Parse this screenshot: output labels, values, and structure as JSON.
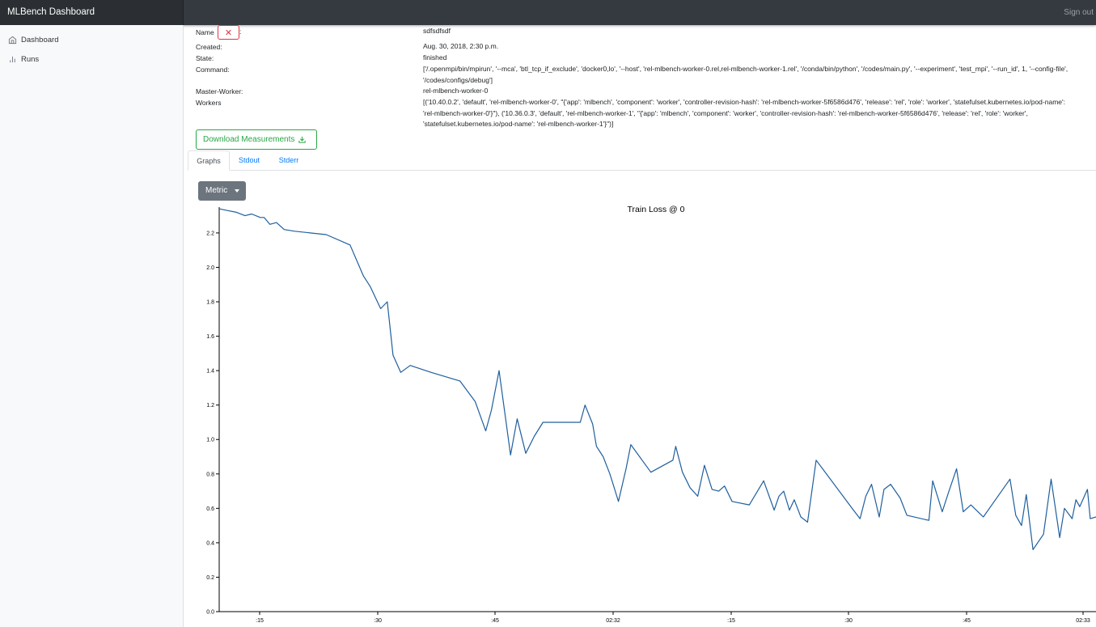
{
  "navbar": {
    "brand": "MLBench Dashboard",
    "signout": "Sign out"
  },
  "sidebar": {
    "items": [
      {
        "label": "Dashboard",
        "icon": "home-icon"
      },
      {
        "label": "Runs",
        "icon": "bar-chart-icon"
      }
    ]
  },
  "details": {
    "name_label": "Name",
    "name_colon": ":",
    "close_glyph": "✕",
    "name_value": "sdfsdfsdf",
    "created_label": "Created:",
    "created_value": "Aug. 30, 2018, 2:30 p.m.",
    "state_label": "State:",
    "state_value": "finished",
    "command_label": "Command:",
    "command_value": "['/.openmpi/bin/mpirun', '--mca', 'btl_tcp_if_exclude', 'docker0,lo', '--host', 'rel-mlbench-worker-0.rel,rel-mlbench-worker-1.rel', '/conda/bin/python', '/codes/main.py', '--experiment', 'test_mpi', '--run_id', 1, '--config-file', '/codes/configs/debug']",
    "master_label": "Master-Worker:",
    "master_value": "rel-mlbench-worker-0",
    "workers_label": "Workers",
    "workers_value": "[('10.40.0.2', 'default', 'rel-mlbench-worker-0', \"{'app': 'mlbench', 'component': 'worker', 'controller-revision-hash': 'rel-mlbench-worker-5f6586d476', 'release': 'rel', 'role': 'worker', 'statefulset.kubernetes.io/pod-name': 'rel-mlbench-worker-0'}\"), ('10.36.0.3', 'default', 'rel-mlbench-worker-1', \"{'app': 'mlbench', 'component': 'worker', 'controller-revision-hash': 'rel-mlbench-worker-5f6586d476', 'release': 'rel', 'role': 'worker', 'statefulset.kubernetes.io/pod-name': 'rel-mlbench-worker-1'}\")]"
  },
  "download_button": {
    "label": "Download Measurements"
  },
  "tabs": [
    {
      "label": "Graphs",
      "active": true
    },
    {
      "label": "Stdout",
      "active": false
    },
    {
      "label": "Stderr",
      "active": false
    }
  ],
  "metric_dropdown": {
    "label": "Metric"
  },
  "colors": {
    "navbar": "#343a40",
    "success": "#28a745",
    "danger": "#dc3545",
    "link": "#007bff",
    "line": "#1f5f9e"
  },
  "chart_data": {
    "type": "line",
    "title": "Train Loss @ 0",
    "ylim": [
      0,
      2.35
    ],
    "yticks": [
      "0.0",
      "0.2",
      "0.4",
      "0.6",
      "0.8",
      "1.0",
      "1.2",
      "1.4",
      "1.6",
      "1.8",
      "2.0",
      "2.2"
    ],
    "ytick_values": [
      0,
      0.2,
      0.4,
      0.6,
      0.8,
      1.0,
      1.2,
      1.4,
      1.6,
      1.8,
      2.0,
      2.2
    ],
    "xlim": [
      9.3,
      101.1
    ],
    "xticks": [
      ":15",
      ":30",
      ":45",
      "02:32",
      ":15",
      ":30",
      ":45",
      "02:33"
    ],
    "xtick_values": [
      15,
      30,
      45,
      60,
      75,
      90,
      105,
      120
    ],
    "x": [
      9.3,
      10.2,
      11.1,
      12.0,
      12.7,
      13.6,
      14.0,
      14.6,
      15.3,
      16.1,
      17.2,
      20.5,
      23.0,
      24.4,
      25.1,
      26.2,
      26.9,
      27.5,
      28.3,
      29.3,
      31.5,
      34.5,
      36.1,
      37.2,
      37.8,
      38.6,
      39.8,
      40.5,
      41.4,
      42.3,
      43.2,
      44.5,
      47.1,
      47.6,
      48.4,
      48.8,
      49.5,
      50.2,
      51.1,
      51.9,
      52.4,
      54.5,
      56.8,
      57.1,
      57.8,
      58.6,
      59.4,
      60.1,
      60.9,
      61.6,
      62.2,
      63.0,
      64.8,
      66.3,
      67.4,
      67.9,
      68.4,
      69.0,
      69.5,
      70.2,
      70.9,
      71.8,
      75.7,
      76.4,
      77.0,
      77.6,
      78.4,
      78.9,
      79.6,
      80.6,
      81.3,
      83.6,
      84.0,
      85.0,
      85.7,
      86.5,
      87.2,
      88.0,
      89.3,
      92.1,
      92.7,
      93.3,
      93.8,
      94.5,
      95.6,
      96.4,
      97.3,
      97.8,
      98.6,
      99.0,
      99.4,
      100.2,
      100.5,
      101.1
    ],
    "y": [
      2.34,
      2.33,
      2.32,
      2.3,
      2.31,
      2.29,
      2.29,
      2.25,
      2.26,
      2.22,
      2.21,
      2.19,
      2.13,
      1.95,
      1.89,
      1.76,
      1.8,
      1.49,
      1.39,
      1.43,
      1.39,
      1.34,
      1.22,
      1.05,
      1.17,
      1.4,
      0.91,
      1.12,
      0.92,
      1.02,
      1.1,
      1.1,
      1.1,
      1.2,
      1.09,
      0.96,
      0.9,
      0.8,
      0.64,
      0.83,
      0.97,
      0.81,
      0.88,
      0.96,
      0.81,
      0.72,
      0.67,
      0.85,
      0.71,
      0.7,
      0.73,
      0.64,
      0.62,
      0.76,
      0.59,
      0.67,
      0.7,
      0.59,
      0.65,
      0.55,
      0.52,
      0.88,
      0.59,
      0.54,
      0.67,
      0.74,
      0.55,
      0.71,
      0.74,
      0.66,
      0.56,
      0.53,
      0.76,
      0.58,
      0.7,
      0.83,
      0.58,
      0.62,
      0.55,
      0.77,
      0.56,
      0.5,
      0.68,
      0.36,
      0.45,
      0.77,
      0.43,
      0.6,
      0.54,
      0.65,
      0.61,
      0.71,
      0.54,
      0.55,
      0.6,
      0.4,
      0.61,
      0.42
    ]
  }
}
